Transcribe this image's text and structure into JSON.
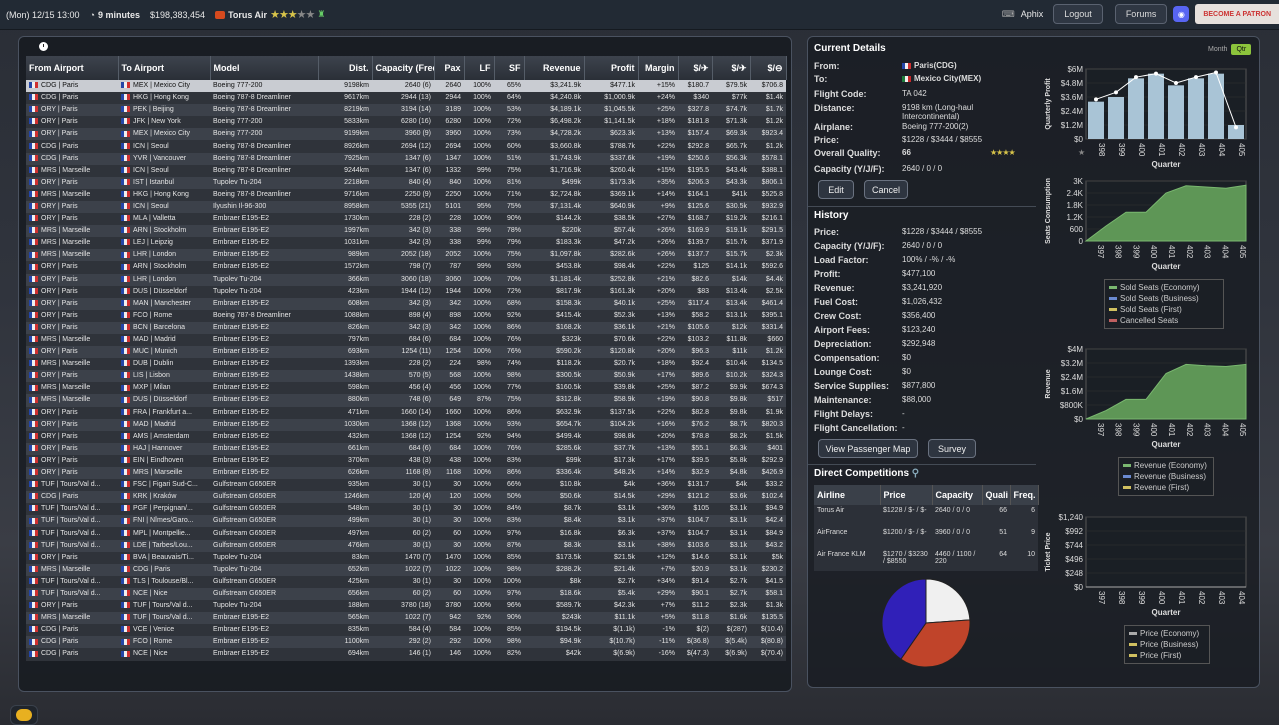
{
  "topbar": {
    "date": "(Mon) 12/15 13:00",
    "speed": "9 minutes",
    "cash": "$198,383,454",
    "airline": "Torus Air",
    "user": "Aphix",
    "logout": "Logout",
    "forums": "Forums",
    "patron": "BECOME A PATRON",
    "stars_on": 3,
    "stars_total": 5
  },
  "table": {
    "headers": [
      "From Airport",
      "To Airport",
      "Model",
      "Dist.",
      "Capacity (Freq.)",
      "Pax",
      "LF",
      "SF",
      "Revenue",
      "Profit",
      "Margin",
      "$/✈",
      "$/✈",
      "$/⊖"
    ],
    "rows": [
      [
        "CDG | Paris",
        "MEX | Mexico City",
        "Boeing 777-200",
        "9198km",
        "2640 (6)",
        "2640",
        "100%",
        "65%",
        "$3,241.9k",
        "$477.1k",
        "+15%",
        "$180.7",
        "$79.5k",
        "$706.8"
      ],
      [
        "HKG | Hong Kong",
        "Boeing 787-8 Dreamliner",
        "9617km",
        "2944 (13)",
        "2944",
        "100%",
        "64%",
        "$4,240.8k",
        "$1,000.9k",
        "+24%",
        "$340",
        "$77k",
        "$1.4k"
      ],
      [
        "PEK | Beijing",
        "Boeing 787-8 Dreamliner",
        "8219km",
        "3194 (14)",
        "3189",
        "100%",
        "53%",
        "$4,189.1k",
        "$1,045.5k",
        "+25%",
        "$327.8",
        "$74.7k",
        "$1.7k"
      ],
      [
        "JFK | New York",
        "Boeing 777-200",
        "5833km",
        "6280 (16)",
        "6280",
        "100%",
        "72%",
        "$6,498.2k",
        "$1,141.5k",
        "+18%",
        "$181.8",
        "$71.3k",
        "$1.2k"
      ],
      [
        "MEX | Mexico City",
        "Boeing 777-200",
        "9199km",
        "3960 (9)",
        "3960",
        "100%",
        "73%",
        "$4,728.2k",
        "$623.3k",
        "+13%",
        "$157.4",
        "$69.3k",
        "$923.4"
      ],
      [
        "ICN | Seoul",
        "Boeing 787-8 Dreamliner",
        "8926km",
        "2694 (12)",
        "2694",
        "100%",
        "60%",
        "$3,660.8k",
        "$788.7k",
        "+22%",
        "$292.8",
        "$65.7k",
        "$1.2k"
      ],
      [
        "YVR | Vancouver",
        "Boeing 787-8 Dreamliner",
        "7925km",
        "1347 (6)",
        "1347",
        "100%",
        "51%",
        "$1,743.9k",
        "$337.6k",
        "+19%",
        "$250.6",
        "$56.3k",
        "$578.1"
      ],
      [
        "ICN | Seoul",
        "Boeing 787-8 Dreamliner",
        "9244km",
        "1347 (6)",
        "1332",
        "99%",
        "75%",
        "$1,716.9k",
        "$260.4k",
        "+15%",
        "$195.5",
        "$43.4k",
        "$388.1"
      ],
      [
        "IST | Istanbul",
        "Tupolev Tu-204",
        "2218km",
        "840 (4)",
        "840",
        "100%",
        "81%",
        "$499k",
        "$173.3k",
        "+35%",
        "$206.3",
        "$43.3k",
        "$806.1"
      ],
      [
        "HKG | Hong Kong",
        "Boeing 787-8 Dreamliner",
        "9716km",
        "2250 (9)",
        "2250",
        "100%",
        "71%",
        "$2,724.8k",
        "$369.1k",
        "+14%",
        "$164.1",
        "$41k",
        "$525.8"
      ],
      [
        "ICN | Seoul",
        "Ilyushin Il-96-300",
        "8958km",
        "5355 (21)",
        "5101",
        "95%",
        "75%",
        "$7,131.4k",
        "$640.9k",
        "+9%",
        "$125.6",
        "$30.5k",
        "$932.9"
      ],
      [
        "MLA | Valletta",
        "Embraer E195-E2",
        "1730km",
        "228 (2)",
        "228",
        "100%",
        "90%",
        "$144.2k",
        "$38.5k",
        "+27%",
        "$168.7",
        "$19.2k",
        "$216.1"
      ],
      [
        "ARN | Stockholm",
        "Embraer E195-E2",
        "1997km",
        "342 (3)",
        "338",
        "99%",
        "78%",
        "$220k",
        "$57.4k",
        "+26%",
        "$169.9",
        "$19.1k",
        "$291.5"
      ],
      [
        "LEJ | Leipzig",
        "Embraer E195-E2",
        "1031km",
        "342 (3)",
        "338",
        "99%",
        "79%",
        "$183.3k",
        "$47.2k",
        "+26%",
        "$139.7",
        "$15.7k",
        "$371.9"
      ],
      [
        "LHR | London",
        "Embraer E195-E2",
        "989km",
        "2052 (18)",
        "2052",
        "100%",
        "75%",
        "$1,097.8k",
        "$282.6k",
        "+26%",
        "$137.7",
        "$15.7k",
        "$2.3k"
      ],
      [
        "ARN | Stockholm",
        "Embraer E195-E2",
        "1572km",
        "798 (7)",
        "787",
        "99%",
        "93%",
        "$453.8k",
        "$98.4k",
        "+22%",
        "$125",
        "$14.1k",
        "$592.6"
      ],
      [
        "LHR | London",
        "Tupolev Tu-204",
        "366km",
        "3060 (18)",
        "3060",
        "100%",
        "70%",
        "$1,181.4k",
        "$252.8k",
        "+21%",
        "$82.6",
        "$14k",
        "$4.4k"
      ],
      [
        "DUS | Düsseldorf",
        "Tupolev Tu-204",
        "423km",
        "1944 (12)",
        "1944",
        "100%",
        "72%",
        "$817.9k",
        "$161.3k",
        "+20%",
        "$83",
        "$13.4k",
        "$2.5k"
      ],
      [
        "MAN | Manchester",
        "Embraer E195-E2",
        "608km",
        "342 (3)",
        "342",
        "100%",
        "68%",
        "$158.3k",
        "$40.1k",
        "+25%",
        "$117.4",
        "$13.4k",
        "$461.4"
      ],
      [
        "FCO | Rome",
        "Boeing 787-8 Dreamliner",
        "1088km",
        "898 (4)",
        "898",
        "100%",
        "92%",
        "$415.4k",
        "$52.3k",
        "+13%",
        "$58.2",
        "$13.1k",
        "$395.1"
      ],
      [
        "BCN | Barcelona",
        "Embraer E195-E2",
        "826km",
        "342 (3)",
        "342",
        "100%",
        "86%",
        "$168.2k",
        "$36.1k",
        "+21%",
        "$105.6",
        "$12k",
        "$331.4"
      ],
      [
        "MAD | Madrid",
        "Embraer E195-E2",
        "797km",
        "684 (6)",
        "684",
        "100%",
        "76%",
        "$323k",
        "$70.6k",
        "+22%",
        "$103.2",
        "$11.8k",
        "$660"
      ],
      [
        "MUC | Munich",
        "Embraer E195-E2",
        "693km",
        "1254 (11)",
        "1254",
        "100%",
        "76%",
        "$590.2k",
        "$120.8k",
        "+20%",
        "$96.3",
        "$11k",
        "$1.2k"
      ],
      [
        "DUB | Dublin",
        "Embraer E195-E2",
        "1393km",
        "228 (2)",
        "224",
        "98%",
        "74%",
        "$118.2k",
        "$20.7k",
        "+18%",
        "$92.4",
        "$10.4k",
        "$134.5"
      ],
      [
        "LIS | Lisbon",
        "Embraer E195-E2",
        "1438km",
        "570 (5)",
        "568",
        "100%",
        "98%",
        "$300.5k",
        "$50.9k",
        "+17%",
        "$89.6",
        "$10.2k",
        "$324.3"
      ],
      [
        "MXP | Milan",
        "Embraer E195-E2",
        "598km",
        "456 (4)",
        "456",
        "100%",
        "77%",
        "$160.5k",
        "$39.8k",
        "+25%",
        "$87.2",
        "$9.9k",
        "$674.3"
      ],
      [
        "DUS | Düsseldorf",
        "Embraer E195-E2",
        "880km",
        "748 (6)",
        "649",
        "87%",
        "75%",
        "$312.8k",
        "$58.9k",
        "+19%",
        "$90.8",
        "$9.8k",
        "$517"
      ],
      [
        "FRA | Frankfurt a...",
        "Embraer E195-E2",
        "471km",
        "1660 (14)",
        "1660",
        "100%",
        "86%",
        "$632.9k",
        "$137.5k",
        "+22%",
        "$82.8",
        "$9.8k",
        "$1.9k"
      ],
      [
        "MAD | Madrid",
        "Embraer E195-E2",
        "1030km",
        "1368 (12)",
        "1368",
        "100%",
        "93%",
        "$654.7k",
        "$104.2k",
        "+16%",
        "$76.2",
        "$8.7k",
        "$820.3"
      ],
      [
        "AMS | Amsterdam",
        "Embraer E195-E2",
        "432km",
        "1368 (12)",
        "1254",
        "92%",
        "94%",
        "$499.4k",
        "$98.8k",
        "+20%",
        "$78.8",
        "$8.2k",
        "$1.5k"
      ],
      [
        "HAJ | Hannover",
        "Embraer E195-E2",
        "661km",
        "684 (6)",
        "684",
        "100%",
        "76%",
        "$285.6k",
        "$37.7k",
        "+13%",
        "$55.1",
        "$6.3k",
        "$401"
      ],
      [
        "EIN | Eindhoven",
        "Embraer E195-E2",
        "370km",
        "438 (3)",
        "438",
        "100%",
        "83%",
        "$99k",
        "$17.3k",
        "+17%",
        "$39.5",
        "$5.8k",
        "$292.9"
      ],
      [
        "MRS | Marseille",
        "Embraer E195-E2",
        "626km",
        "1168 (8)",
        "1168",
        "100%",
        "86%",
        "$336.4k",
        "$48.2k",
        "+14%",
        "$32.9",
        "$4.8k",
        "$426.9"
      ],
      [
        "FSC | Figari Sud-C...",
        "Gulfstream G650ER",
        "935km",
        "30 (1)",
        "30",
        "100%",
        "66%",
        "$10.8k",
        "$4k",
        "+36%",
        "$131.7",
        "$4k",
        "$33.2"
      ],
      [
        "KRK | Kraków",
        "Gulfstream G650ER",
        "1246km",
        "120 (4)",
        "120",
        "100%",
        "50%",
        "$50.6k",
        "$14.5k",
        "+29%",
        "$121.2",
        "$3.6k",
        "$102.4"
      ],
      [
        "PGF | Perpignan/...",
        "Gulfstream G650ER",
        "548km",
        "30 (1)",
        "30",
        "100%",
        "84%",
        "$8.7k",
        "$3.1k",
        "+36%",
        "$105",
        "$3.1k",
        "$94.9"
      ],
      [
        "FNI | Nîmes/Garo...",
        "Gulfstream G650ER",
        "499km",
        "30 (1)",
        "30",
        "100%",
        "83%",
        "$8.4k",
        "$3.1k",
        "+37%",
        "$104.7",
        "$3.1k",
        "$42.4"
      ],
      [
        "MPL | Montpellie...",
        "Gulfstream G650ER",
        "497km",
        "60 (2)",
        "60",
        "100%",
        "97%",
        "$16.8k",
        "$6.3k",
        "+37%",
        "$104.7",
        "$3.1k",
        "$84.9"
      ],
      [
        "LDE | Tarbes/Lou...",
        "Gulfstream G650ER",
        "476km",
        "30 (1)",
        "30",
        "100%",
        "87%",
        "$8.3k",
        "$3.1k",
        "+38%",
        "$103.6",
        "$3.1k",
        "$43.2"
      ],
      [
        "BVA | Beauvais/Ti...",
        "Tupolev Tu-204",
        "83km",
        "1470 (7)",
        "1470",
        "100%",
        "85%",
        "$173.5k",
        "$21.5k",
        "+12%",
        "$14.6",
        "$3.1k",
        "$5k"
      ],
      [
        "CDG | Paris",
        "Tupolev Tu-204",
        "652km",
        "1022 (7)",
        "1022",
        "100%",
        "98%",
        "$288.2k",
        "$21.4k",
        "+7%",
        "$20.9",
        "$3.1k",
        "$230.2"
      ],
      [
        "TLS | Toulouse/Bl...",
        "Gulfstream G650ER",
        "425km",
        "30 (1)",
        "30",
        "100%",
        "100%",
        "$8k",
        "$2.7k",
        "+34%",
        "$91.4",
        "$2.7k",
        "$41.5"
      ],
      [
        "NCE | Nice",
        "Gulfstream G650ER",
        "656km",
        "60 (2)",
        "60",
        "100%",
        "97%",
        "$18.6k",
        "$5.4k",
        "+29%",
        "$90.1",
        "$2.7k",
        "$58.1"
      ],
      [
        "TUF | Tours/Val d...",
        "Tupolev Tu-204",
        "188km",
        "3780 (18)",
        "3780",
        "100%",
        "96%",
        "$589.7k",
        "$42.3k",
        "+7%",
        "$11.2",
        "$2.3k",
        "$1.3k"
      ],
      [
        "TUF | Tours/Val d...",
        "Embraer E195-E2",
        "565km",
        "1022 (7)",
        "942",
        "92%",
        "90%",
        "$243k",
        "$11.1k",
        "+5%",
        "$11.8",
        "$1.6k",
        "$135.5"
      ],
      [
        "VCE | Venice",
        "Embraer E195-E2",
        "835km",
        "584 (4)",
        "584",
        "100%",
        "85%",
        "$194.5k",
        "$(1.1k)",
        "-1%",
        "$(2)",
        "$(287)",
        "$(10.4)"
      ],
      [
        "FCO | Rome",
        "Embraer E195-E2",
        "1100km",
        "292 (2)",
        "292",
        "100%",
        "98%",
        "$94.9k",
        "$(10.7k)",
        "-11%",
        "$(36.8)",
        "$(5.4k)",
        "$(80.8)"
      ],
      [
        "NCE | Nice",
        "Embraer E195-E2",
        "694km",
        "146 (1)",
        "146",
        "100%",
        "82%",
        "$42k",
        "$(6.9k)",
        "-16%",
        "$(47.3)",
        "$(6.9k)",
        "$(70.4)"
      ]
    ],
    "from": [
      "CDG | Paris",
      "CDG | Paris",
      "ORY | Paris",
      "ORY | Paris",
      "ORY | Paris",
      "CDG | Paris",
      "CDG | Paris",
      "MRS | Marseille",
      "ORY | Paris",
      "MRS | Marseille",
      "ORY | Paris",
      "ORY | Paris",
      "MRS | Marseille",
      "MRS | Marseille",
      "MRS | Marseille",
      "ORY | Paris",
      "ORY | Paris",
      "ORY | Paris",
      "ORY | Paris",
      "ORY | Paris",
      "ORY | Paris",
      "MRS | Marseille",
      "ORY | Paris",
      "MRS | Marseille",
      "ORY | Paris",
      "MRS | Marseille",
      "MRS | Marseille",
      "ORY | Paris",
      "ORY | Paris",
      "ORY | Paris",
      "ORY | Paris",
      "ORY | Paris",
      "ORY | Paris",
      "TUF | Tours/Val d...",
      "CDG | Paris",
      "TUF | Tours/Val d...",
      "TUF | Tours/Val d...",
      "TUF | Tours/Val d...",
      "TUF | Tours/Val d...",
      "ORY | Paris",
      "MRS | Marseille",
      "TUF | Tours/Val d...",
      "TUF | Tours/Val d...",
      "ORY | Paris",
      "MRS | Marseille",
      "CDG | Paris",
      "CDG | Paris",
      "CDG | Paris"
    ]
  },
  "details": {
    "title": "Current Details",
    "from_l": "From:",
    "from": "Paris(CDG)",
    "to_l": "To:",
    "to": "Mexico City(MEX)",
    "code_l": "Flight Code:",
    "code": "TA 042",
    "dist_l": "Distance:",
    "dist": "9198 km (Long-haul Intercontinental)",
    "plane_l": "Airplane:",
    "plane": "Boeing 777-200(2)",
    "price_l": "Price:",
    "price": "$1228 / $3444 / $8555",
    "qual_l": "Overall Quality:",
    "qual": "66",
    "cap_l": "Capacity (Y/J/F):",
    "cap": "2640 / 0 / 0",
    "edit": "Edit",
    "cancel": "Cancel"
  },
  "history": {
    "title": "History",
    "rows": [
      [
        "Price:",
        "$1228 / $3444 / $8555"
      ],
      [
        "Capacity (Y/J/F):",
        "2640 / 0 / 0"
      ],
      [
        "Load Factor:",
        "100% / -% / -%"
      ],
      [
        "Profit:",
        "$477,100"
      ],
      [
        "Revenue:",
        "$3,241,920"
      ],
      [
        "Fuel Cost:",
        "$1,026,432"
      ],
      [
        "Crew Cost:",
        "$356,400"
      ],
      [
        "Airport Fees:",
        "$123,240"
      ],
      [
        "Depreciation:",
        "$292,948"
      ],
      [
        "Compensation:",
        "$0"
      ],
      [
        "Lounge Cost:",
        "$0"
      ],
      [
        "Service Supplies:",
        "$877,800"
      ],
      [
        "Maintenance:",
        "$88,000"
      ],
      [
        "Flight Delays:",
        "-"
      ],
      [
        "Flight Cancellation:",
        "-"
      ]
    ],
    "view": "View Passenger Map",
    "survey": "Survey"
  },
  "comp": {
    "title": "Direct Competitions",
    "headers": [
      "Airline",
      "Price",
      "Capacity",
      "Quali",
      "Freq."
    ],
    "rows": [
      [
        "Torus Air",
        "$1228 / $- / $-",
        "2640 / 0 / 0",
        "66",
        "6"
      ],
      [
        "AirFrance",
        "$1200 / $- / $-",
        "3960 / 0 / 0",
        "51",
        "9"
      ],
      [
        "Air France KLM",
        "$1270 / $3230 / $8550",
        "4460 / 1100 / 220",
        "64",
        "10"
      ]
    ]
  },
  "toggle": {
    "month": "Month",
    "qtr": "Qtr"
  },
  "chart_data": [
    {
      "type": "bar",
      "title": "",
      "ylabel": "Quarterly Profit",
      "xlabel": "Quarter",
      "categories": [
        "398",
        "399",
        "400",
        "401",
        "402",
        "403",
        "404",
        "405"
      ],
      "values": [
        3.2,
        3.6,
        5.2,
        5.6,
        4.6,
        5.2,
        5.6,
        1.2
      ],
      "line": [
        3.4,
        4.0,
        5.3,
        5.6,
        4.8,
        5.3,
        5.7,
        1.0
      ],
      "yticks": [
        "$0",
        "$1.2M",
        "$2.4M",
        "$3.6M",
        "$4.8M",
        "$6M"
      ],
      "ylim": [
        0,
        6
      ]
    },
    {
      "type": "area",
      "ylabel": "Seats Consumption",
      "xlabel": "Quarter",
      "categories": [
        "397",
        "398",
        "399",
        "400",
        "401",
        "402",
        "403",
        "404",
        "405"
      ],
      "yticks": [
        "0",
        "600",
        "1.2K",
        "1.8K",
        "2.4K",
        "3K"
      ],
      "ylim": [
        0,
        3000
      ],
      "legend": [
        "Sold Seats (Economy)",
        "Sold Seats (Business)",
        "Sold Seats (First)",
        "Cancelled Seats"
      ]
    },
    {
      "type": "area",
      "ylabel": "Revenue",
      "xlabel": "Quarter",
      "categories": [
        "397",
        "398",
        "399",
        "400",
        "401",
        "402",
        "403",
        "404",
        "405"
      ],
      "yticks": [
        "$0",
        "$800K",
        "$1.6M",
        "$2.4M",
        "$3.2M",
        "$4M"
      ],
      "ylim": [
        0,
        4
      ],
      "legend": [
        "Revenue (Economy)",
        "Revenue (Business)",
        "Revenue (First)"
      ]
    },
    {
      "type": "line",
      "ylabel": "Ticket Price",
      "xlabel": "Quarter",
      "categories": [
        "397",
        "398",
        "399",
        "400",
        "401",
        "402",
        "403",
        "404"
      ],
      "yticks": [
        "$0",
        "$248",
        "$496",
        "$744",
        "$992",
        "$1,240"
      ],
      "ylim": [
        0,
        1240
      ],
      "legend": [
        "Price (Economy)",
        "Price (Business)",
        "Price (First)"
      ]
    },
    {
      "type": "pie",
      "values": [
        2640,
        3960,
        4460
      ],
      "colors": [
        "#f0f0f0",
        "#c0442a",
        "#3020b8"
      ]
    }
  ]
}
